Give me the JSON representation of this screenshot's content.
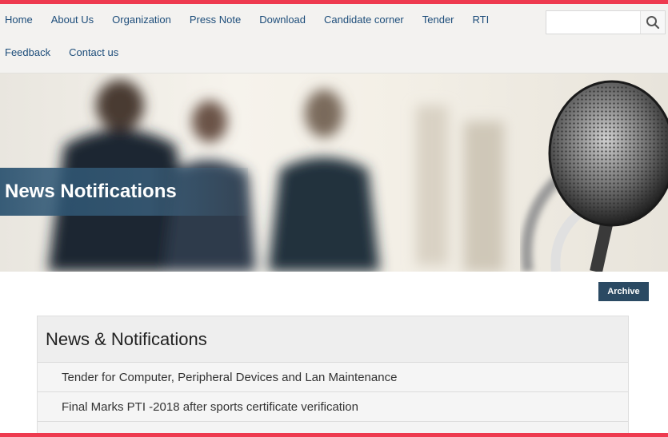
{
  "nav": {
    "row1": [
      "Home",
      "About Us",
      "Organization",
      "Press Note",
      "Download",
      "Candidate corner",
      "Tender",
      "RTI"
    ],
    "row2": [
      "Feedback",
      "Contact us"
    ]
  },
  "search": {
    "placeholder": "",
    "icon": "search-icon"
  },
  "banner": {
    "title": "News Notifications"
  },
  "archive": {
    "label": "Archive"
  },
  "news": {
    "heading": "News & Notifications",
    "items": [
      "Tender for Computer, Peripheral Devices and Lan Maintenance",
      "Final Marks PTI -2018 after sports certificate verification"
    ]
  },
  "colors": {
    "accent_stripe": "#ee3a4f",
    "nav_link": "#1d4d7a",
    "archive_button": "#2b4a63"
  }
}
